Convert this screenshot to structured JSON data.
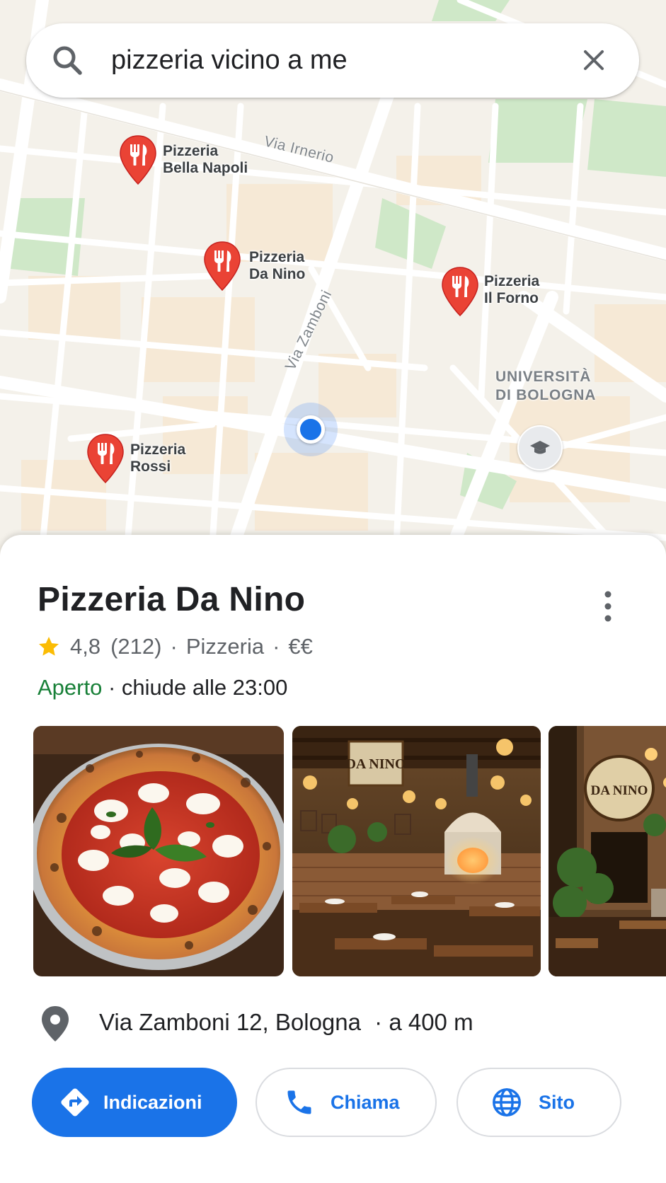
{
  "search": {
    "query": "pizzeria vicino a me",
    "icon": "search-icon",
    "clear_icon": "close-icon"
  },
  "map": {
    "streets": [
      {
        "name": "Via Irnerio"
      },
      {
        "name": "Via Zamboni"
      }
    ],
    "poi": {
      "line1": "UNIVERSITÀ",
      "line2": "DI BOLOGNA",
      "icon": "graduation-cap-icon"
    },
    "pins": [
      {
        "line1": "Pizzeria",
        "line2": "Bella Napoli"
      },
      {
        "line1": "Pizzeria",
        "line2": "Da Nino"
      },
      {
        "line1": "Pizzeria",
        "line2": "Il Forno"
      },
      {
        "line1": "Pizzeria",
        "line2": "Rossi"
      }
    ],
    "colors": {
      "pin": "#ea4335",
      "location": "#1a73e8",
      "park": "#c8e6c0"
    }
  },
  "place": {
    "name": "Pizzeria Da Nino",
    "rating": "4,8",
    "reviews": "(212)",
    "category": "Pizzeria",
    "price": "€€",
    "separator": "·",
    "status": "Aperto",
    "hours": "· chiude alle 23:00",
    "address": "Via Zamboni 12, Bologna",
    "distance": "· a 400 m",
    "photos": [
      {
        "subject": "pizza margherita"
      },
      {
        "subject": "interno del ristorante",
        "sign": "DA NINO"
      },
      {
        "subject": "ingresso del ristorante",
        "sign": "DA NINO"
      }
    ]
  },
  "actions": {
    "directions": "Indicazioni",
    "call": "Chiama",
    "website": "Sito"
  },
  "colors": {
    "accent": "#1a73e8",
    "open": "#188038",
    "star": "#fbbc04"
  }
}
